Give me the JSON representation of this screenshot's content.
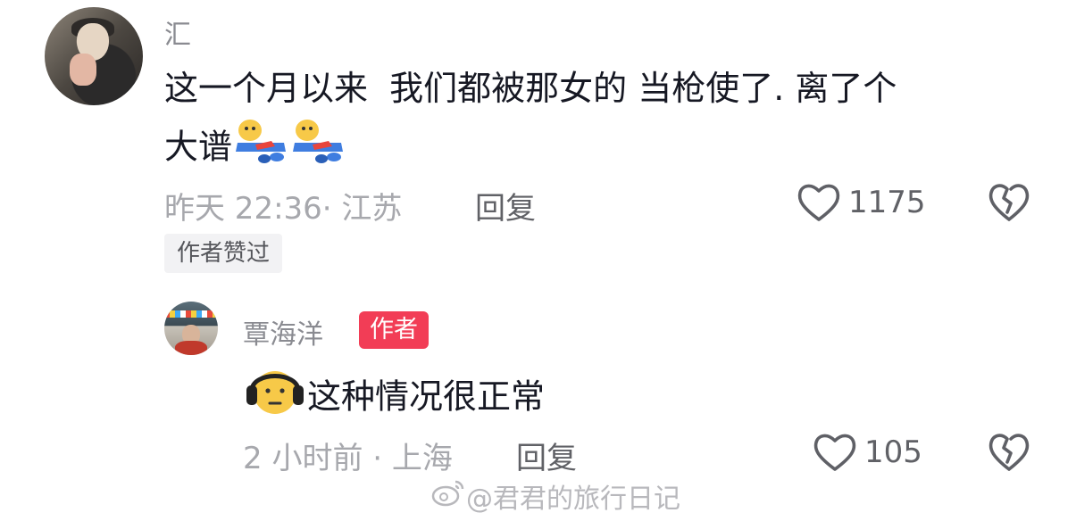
{
  "comment": {
    "username": "汇",
    "text_line1": "这一个月以来  我们都被那女的 当枪使了. 离了个",
    "text_line2": "大谱",
    "time": "昨天 22:36",
    "location_sep": "·",
    "location": "江苏",
    "reply_label": "回复",
    "like_count": "1175",
    "author_liked_badge": "作者赞过",
    "emojis": [
      "lying-flat-emoji",
      "lying-flat-emoji"
    ]
  },
  "reply": {
    "username": "覃海洋",
    "author_tag": "作者",
    "text": "这种情况很正常",
    "emoji": "headphones-face-emoji",
    "time": "2 小时前",
    "location_sep": "·",
    "location": "上海",
    "reply_label": "回复",
    "like_count": "105"
  },
  "watermark": {
    "text": "@君君的旅行日记",
    "icon": "weibo-logo-icon"
  },
  "colors": {
    "author_tag_bg": "#f23d56",
    "text_primary": "#161823",
    "text_secondary": "#a7a8ad"
  }
}
